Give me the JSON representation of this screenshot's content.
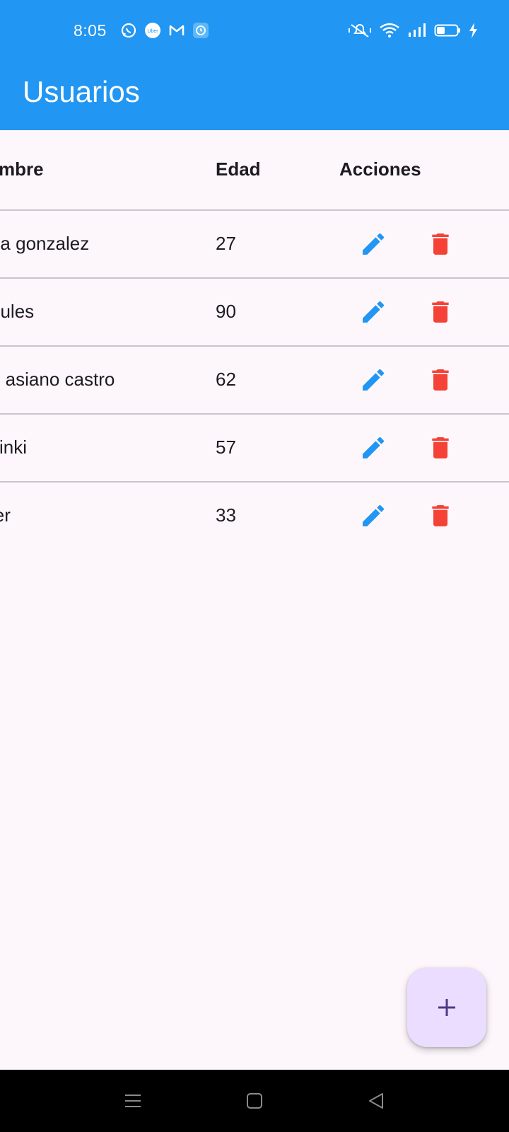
{
  "status_bar": {
    "time": "8:05",
    "notification_icons": [
      "whatsapp-icon",
      "uber-icon",
      "gmail-icon",
      "alarm-app-icon"
    ],
    "system_icons": [
      "vibrate-icon",
      "wifi-icon",
      "signal-icon",
      "battery-icon",
      "charging-icon"
    ],
    "uber_text": "Uber"
  },
  "app_bar": {
    "title": "Usuarios",
    "color": "#2196F3"
  },
  "table": {
    "headers": {
      "name": "mbre",
      "age": "Edad",
      "actions": "Acciones"
    },
    "rows": [
      {
        "name": "rla gonzalez",
        "age": "27"
      },
      {
        "name": "bules",
        "age": "90"
      },
      {
        "name": "n asiano castro",
        "age": "62"
      },
      {
        "name": "sinki",
        "age": "57"
      },
      {
        "name": "ier",
        "age": "33"
      }
    ],
    "edit_icon": "pencil-icon",
    "delete_icon": "trash-icon",
    "edit_color": "#2196F3",
    "delete_color": "#F44336"
  },
  "fab": {
    "icon": "plus-icon",
    "background": "#EADDFF",
    "icon_color": "#4A3B87"
  },
  "nav_bar": {
    "buttons": [
      "menu-icon",
      "home-icon",
      "back-icon"
    ]
  }
}
